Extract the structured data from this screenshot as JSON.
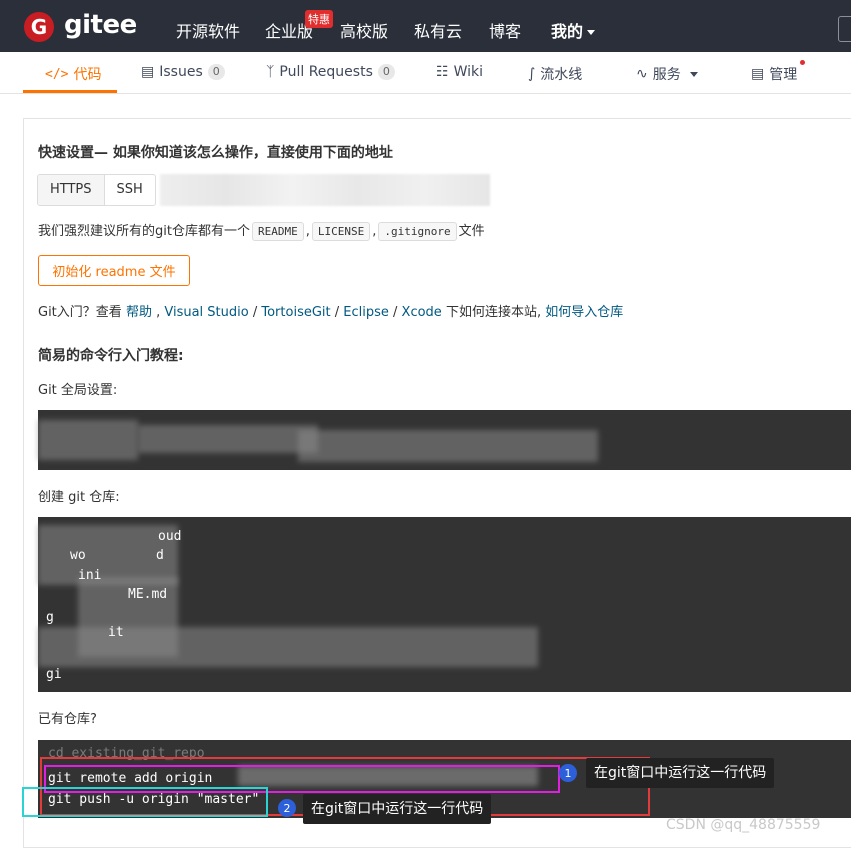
{
  "header": {
    "logo_letter": "G",
    "logo_text": "gitee",
    "nav": [
      "开源软件",
      "企业版",
      "高校版",
      "私有云",
      "博客",
      "我的"
    ],
    "badge": "特惠"
  },
  "tabs": [
    {
      "label": "代码",
      "icon": "code-icon"
    },
    {
      "label": "Issues",
      "count": "0",
      "icon": "issues-icon"
    },
    {
      "label": "Pull Requests",
      "count": "0",
      "icon": "pull-request-icon"
    },
    {
      "label": "Wiki",
      "icon": "book-icon"
    },
    {
      "label": "流水线",
      "icon": "pipeline-icon"
    },
    {
      "label": "服务",
      "icon": "pulse-icon"
    },
    {
      "label": "管理",
      "icon": "clipboard-icon"
    }
  ],
  "quick_setup": {
    "title": "快速设置— 如果你知道该怎么操作，直接使用下面的地址",
    "protocols": [
      "HTTPS",
      "SSH"
    ],
    "recommend_prefix": "我们强烈建议所有的git仓库都有一个",
    "files": [
      "README",
      "LICENSE",
      ".gitignore"
    ],
    "recommend_suffix": "文件",
    "init_button": "初始化 readme 文件"
  },
  "git_intro": {
    "prefix": "Git入门？查看",
    "help": "帮助",
    "tools": [
      "Visual Studio",
      "TortoiseGit",
      "Eclipse",
      "Xcode"
    ],
    "middle": "下如何连接本站,",
    "import_link": "如何导入仓库"
  },
  "tutorial": {
    "title": "简易的命令行入门教程:",
    "global_label": "Git 全局设置:",
    "create_label": "创建 git 仓库:",
    "create_fragments": [
      "oud",
      "wo",
      "d",
      "ini",
      "ME.md",
      "g",
      "it",
      "gi"
    ],
    "existing_label": "已有仓库?",
    "existing_lines": [
      "cd existing_git_repo",
      "git remote add origin",
      "git push -u origin \"master\""
    ]
  },
  "annotations": {
    "tip1": "在git窗口中运行这一行代码",
    "tip2": "在git窗口中运行这一行代码",
    "num1": "1",
    "num2": "2"
  },
  "watermark": "CSDN @qq_48875559",
  "colors": {
    "accent": "#fe7300",
    "topbar": "#2a2f3a",
    "code_bg": "#333333",
    "magenta": "#e020e0",
    "cyan": "#2ad4d4",
    "red": "#e23b3b"
  }
}
